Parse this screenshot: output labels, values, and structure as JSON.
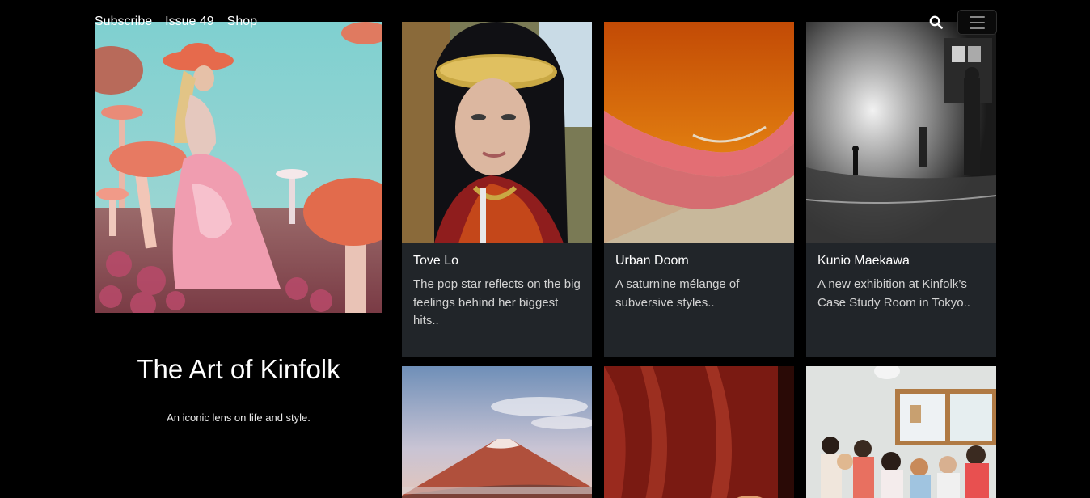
{
  "nav": {
    "items": [
      {
        "label": "Subscribe"
      },
      {
        "label": "Issue 49"
      },
      {
        "label": "Shop"
      }
    ]
  },
  "hero": {
    "title": "The Art of Kinfolk",
    "subtitle": "An iconic lens on life and style."
  },
  "cards": [
    {
      "title": "Tove Lo",
      "description": "The pop star reflects on the big feelings behind her biggest hits.."
    },
    {
      "title": "Urban Doom",
      "description": "A saturnine mélange of subversive styles.."
    },
    {
      "title": "Kunio Maekawa",
      "description": "A new exhibition at Kinfolk’s Case Study Room in Tokyo.."
    }
  ],
  "icons": {
    "search": "search-icon",
    "menu": "menu-icon"
  },
  "colors": {
    "background": "#000000",
    "card_background": "#212529",
    "text": "#ffffff",
    "muted_text": "#d3d3d3"
  }
}
